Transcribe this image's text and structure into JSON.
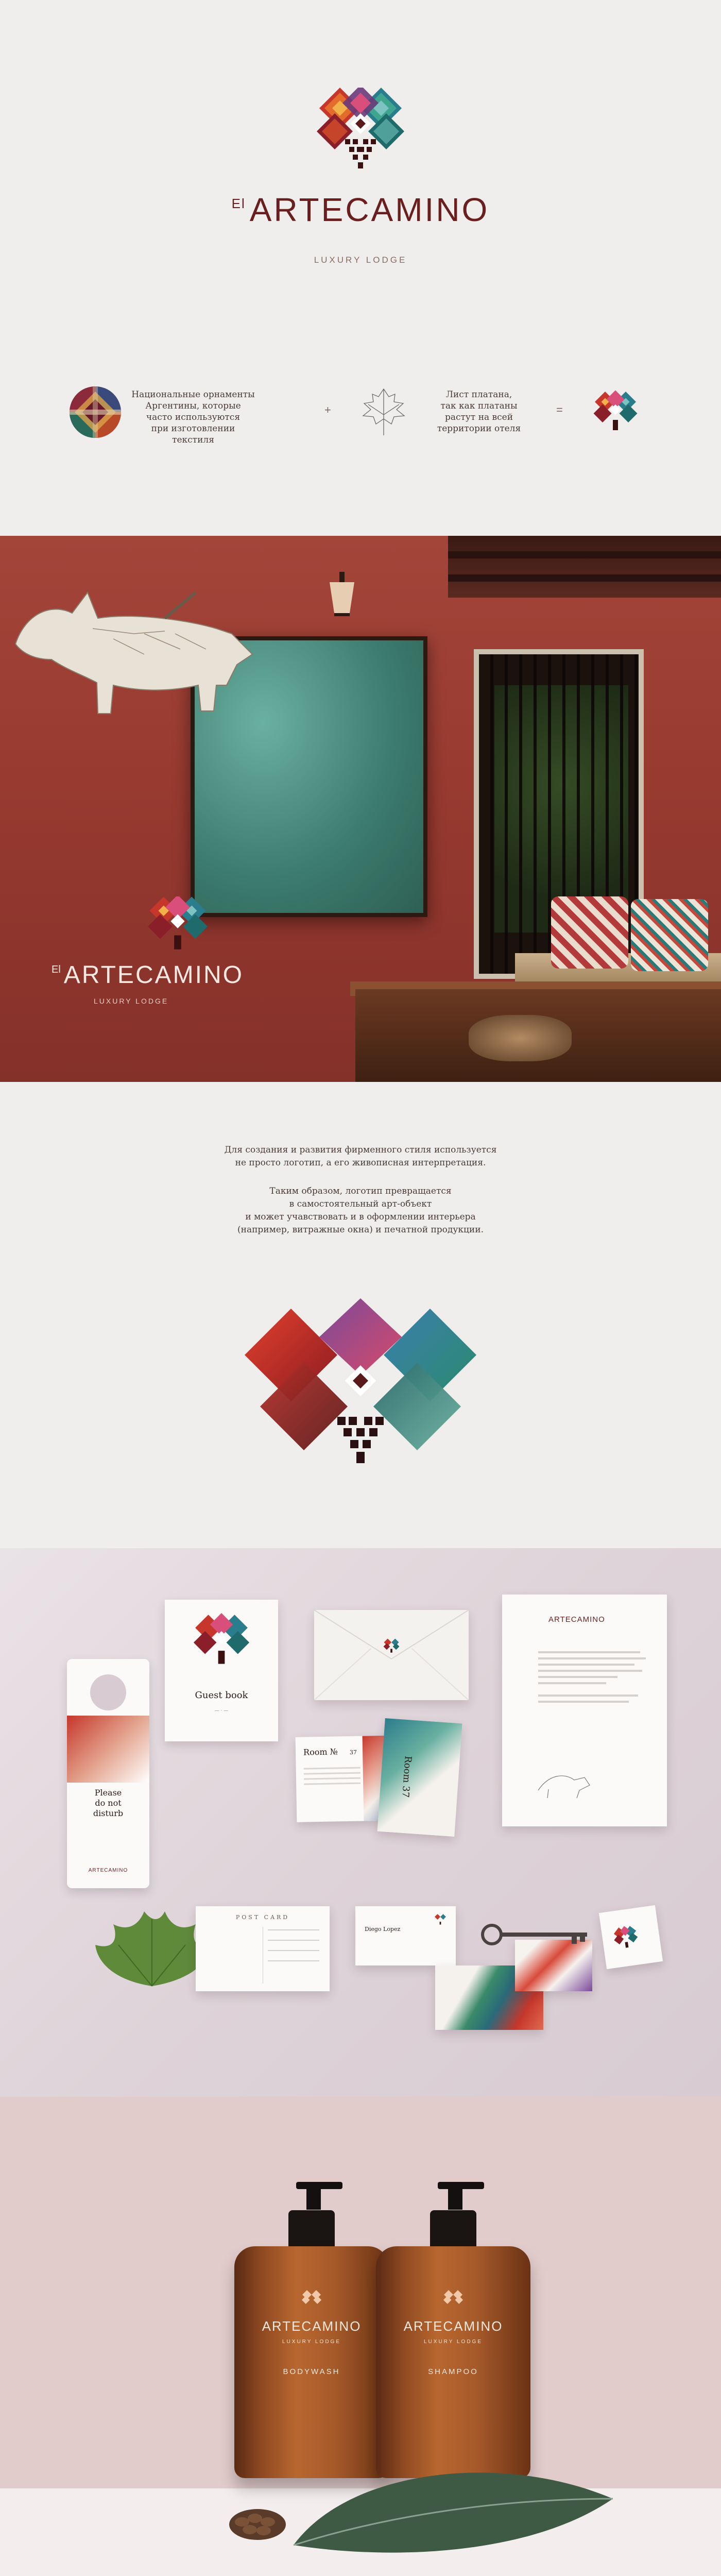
{
  "brand": {
    "prefix": "El",
    "name": "ARTECAMINO",
    "tagline": "LUXURY LODGE"
  },
  "formula": {
    "left_text": "Национальные орнаменты\nАргентины, которые\nчасто используются\nпри изготовлении текстиля",
    "plus": "+",
    "right_text": "Лист платана,\nтак как платаны\nрастут на всей\nтерритории отеля",
    "equals": "="
  },
  "description": {
    "para1": "Для создания и развития фирменного стиля используется\nне просто логотип, а его живописная интерпретация.",
    "para2": "Таким образом, логотип превращается\nв самостоятельный арт-объект\nи может учавствовать и в оформлении интерьера\n(например, витражные окна) и печатной продукции."
  },
  "stationery": {
    "door_hanger": "Please\ndo not\ndisturb",
    "door_brand": "ARTECAMINO",
    "guest_book": "Guest book",
    "room_left": "Room №",
    "room_left_no": "37",
    "room_right": "Room 37",
    "postcard": "POST CARD",
    "card_name": "Diego Lopez",
    "letter_brand": "ARTECAMINO"
  },
  "products": {
    "bottle1": {
      "brand": "ARTECAMINO",
      "sub": "LUXURY LODGE",
      "type": "BODYWASH"
    },
    "bottle2": {
      "brand": "ARTECAMINO",
      "sub": "LUXURY LODGE",
      "type": "SHAMPOO"
    }
  },
  "colors": {
    "brand_red": "#6a1f1f",
    "wall_red": "#9a3b30",
    "bg_light": "#efeeec",
    "bg_pink": "#e2cccb"
  }
}
